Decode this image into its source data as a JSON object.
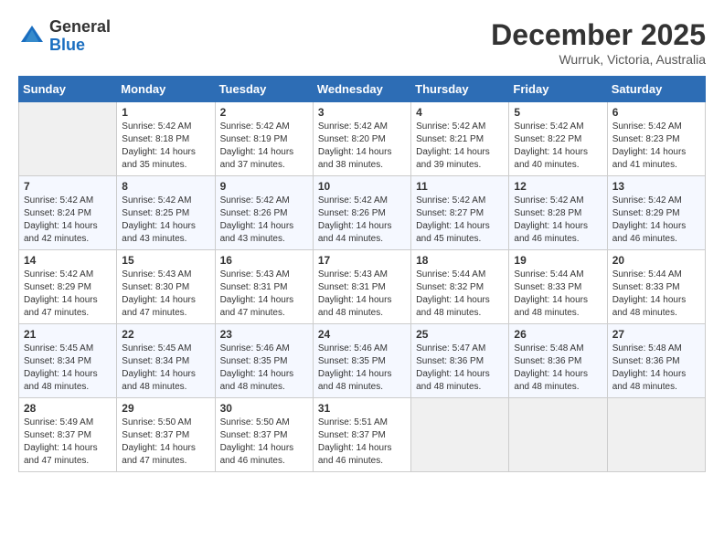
{
  "header": {
    "logo_general": "General",
    "logo_blue": "Blue",
    "month_title": "December 2025",
    "location": "Wurruk, Victoria, Australia"
  },
  "calendar": {
    "days_of_week": [
      "Sunday",
      "Monday",
      "Tuesday",
      "Wednesday",
      "Thursday",
      "Friday",
      "Saturday"
    ],
    "weeks": [
      [
        {
          "day": "",
          "sunrise": "",
          "sunset": "",
          "daylight": ""
        },
        {
          "day": "1",
          "sunrise": "Sunrise: 5:42 AM",
          "sunset": "Sunset: 8:18 PM",
          "daylight": "Daylight: 14 hours and 35 minutes."
        },
        {
          "day": "2",
          "sunrise": "Sunrise: 5:42 AM",
          "sunset": "Sunset: 8:19 PM",
          "daylight": "Daylight: 14 hours and 37 minutes."
        },
        {
          "day": "3",
          "sunrise": "Sunrise: 5:42 AM",
          "sunset": "Sunset: 8:20 PM",
          "daylight": "Daylight: 14 hours and 38 minutes."
        },
        {
          "day": "4",
          "sunrise": "Sunrise: 5:42 AM",
          "sunset": "Sunset: 8:21 PM",
          "daylight": "Daylight: 14 hours and 39 minutes."
        },
        {
          "day": "5",
          "sunrise": "Sunrise: 5:42 AM",
          "sunset": "Sunset: 8:22 PM",
          "daylight": "Daylight: 14 hours and 40 minutes."
        },
        {
          "day": "6",
          "sunrise": "Sunrise: 5:42 AM",
          "sunset": "Sunset: 8:23 PM",
          "daylight": "Daylight: 14 hours and 41 minutes."
        }
      ],
      [
        {
          "day": "7",
          "sunrise": "Sunrise: 5:42 AM",
          "sunset": "Sunset: 8:24 PM",
          "daylight": "Daylight: 14 hours and 42 minutes."
        },
        {
          "day": "8",
          "sunrise": "Sunrise: 5:42 AM",
          "sunset": "Sunset: 8:25 PM",
          "daylight": "Daylight: 14 hours and 43 minutes."
        },
        {
          "day": "9",
          "sunrise": "Sunrise: 5:42 AM",
          "sunset": "Sunset: 8:26 PM",
          "daylight": "Daylight: 14 hours and 43 minutes."
        },
        {
          "day": "10",
          "sunrise": "Sunrise: 5:42 AM",
          "sunset": "Sunset: 8:26 PM",
          "daylight": "Daylight: 14 hours and 44 minutes."
        },
        {
          "day": "11",
          "sunrise": "Sunrise: 5:42 AM",
          "sunset": "Sunset: 8:27 PM",
          "daylight": "Daylight: 14 hours and 45 minutes."
        },
        {
          "day": "12",
          "sunrise": "Sunrise: 5:42 AM",
          "sunset": "Sunset: 8:28 PM",
          "daylight": "Daylight: 14 hours and 46 minutes."
        },
        {
          "day": "13",
          "sunrise": "Sunrise: 5:42 AM",
          "sunset": "Sunset: 8:29 PM",
          "daylight": "Daylight: 14 hours and 46 minutes."
        }
      ],
      [
        {
          "day": "14",
          "sunrise": "Sunrise: 5:42 AM",
          "sunset": "Sunset: 8:29 PM",
          "daylight": "Daylight: 14 hours and 47 minutes."
        },
        {
          "day": "15",
          "sunrise": "Sunrise: 5:43 AM",
          "sunset": "Sunset: 8:30 PM",
          "daylight": "Daylight: 14 hours and 47 minutes."
        },
        {
          "day": "16",
          "sunrise": "Sunrise: 5:43 AM",
          "sunset": "Sunset: 8:31 PM",
          "daylight": "Daylight: 14 hours and 47 minutes."
        },
        {
          "day": "17",
          "sunrise": "Sunrise: 5:43 AM",
          "sunset": "Sunset: 8:31 PM",
          "daylight": "Daylight: 14 hours and 48 minutes."
        },
        {
          "day": "18",
          "sunrise": "Sunrise: 5:44 AM",
          "sunset": "Sunset: 8:32 PM",
          "daylight": "Daylight: 14 hours and 48 minutes."
        },
        {
          "day": "19",
          "sunrise": "Sunrise: 5:44 AM",
          "sunset": "Sunset: 8:33 PM",
          "daylight": "Daylight: 14 hours and 48 minutes."
        },
        {
          "day": "20",
          "sunrise": "Sunrise: 5:44 AM",
          "sunset": "Sunset: 8:33 PM",
          "daylight": "Daylight: 14 hours and 48 minutes."
        }
      ],
      [
        {
          "day": "21",
          "sunrise": "Sunrise: 5:45 AM",
          "sunset": "Sunset: 8:34 PM",
          "daylight": "Daylight: 14 hours and 48 minutes."
        },
        {
          "day": "22",
          "sunrise": "Sunrise: 5:45 AM",
          "sunset": "Sunset: 8:34 PM",
          "daylight": "Daylight: 14 hours and 48 minutes."
        },
        {
          "day": "23",
          "sunrise": "Sunrise: 5:46 AM",
          "sunset": "Sunset: 8:35 PM",
          "daylight": "Daylight: 14 hours and 48 minutes."
        },
        {
          "day": "24",
          "sunrise": "Sunrise: 5:46 AM",
          "sunset": "Sunset: 8:35 PM",
          "daylight": "Daylight: 14 hours and 48 minutes."
        },
        {
          "day": "25",
          "sunrise": "Sunrise: 5:47 AM",
          "sunset": "Sunset: 8:36 PM",
          "daylight": "Daylight: 14 hours and 48 minutes."
        },
        {
          "day": "26",
          "sunrise": "Sunrise: 5:48 AM",
          "sunset": "Sunset: 8:36 PM",
          "daylight": "Daylight: 14 hours and 48 minutes."
        },
        {
          "day": "27",
          "sunrise": "Sunrise: 5:48 AM",
          "sunset": "Sunset: 8:36 PM",
          "daylight": "Daylight: 14 hours and 48 minutes."
        }
      ],
      [
        {
          "day": "28",
          "sunrise": "Sunrise: 5:49 AM",
          "sunset": "Sunset: 8:37 PM",
          "daylight": "Daylight: 14 hours and 47 minutes."
        },
        {
          "day": "29",
          "sunrise": "Sunrise: 5:50 AM",
          "sunset": "Sunset: 8:37 PM",
          "daylight": "Daylight: 14 hours and 47 minutes."
        },
        {
          "day": "30",
          "sunrise": "Sunrise: 5:50 AM",
          "sunset": "Sunset: 8:37 PM",
          "daylight": "Daylight: 14 hours and 46 minutes."
        },
        {
          "day": "31",
          "sunrise": "Sunrise: 5:51 AM",
          "sunset": "Sunset: 8:37 PM",
          "daylight": "Daylight: 14 hours and 46 minutes."
        },
        {
          "day": "",
          "sunrise": "",
          "sunset": "",
          "daylight": ""
        },
        {
          "day": "",
          "sunrise": "",
          "sunset": "",
          "daylight": ""
        },
        {
          "day": "",
          "sunrise": "",
          "sunset": "",
          "daylight": ""
        }
      ]
    ]
  }
}
